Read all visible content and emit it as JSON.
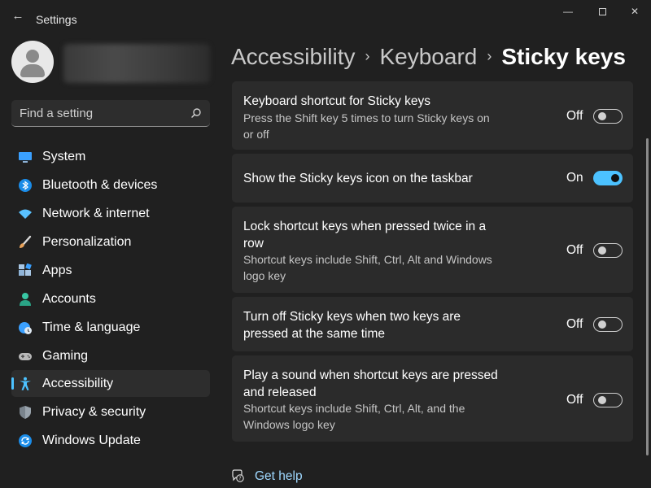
{
  "window": {
    "title": "Settings",
    "back_icon": "←",
    "minimize_icon": "—",
    "close_icon": "✕"
  },
  "search": {
    "placeholder": "Find a setting"
  },
  "sidebar": {
    "items": [
      {
        "label": "System",
        "icon": "system-icon",
        "color": "#3aa0ff"
      },
      {
        "label": "Bluetooth & devices",
        "icon": "bluetooth-icon",
        "color": "#1a8ce8"
      },
      {
        "label": "Network & internet",
        "icon": "wifi-icon",
        "color": "#59c1ff"
      },
      {
        "label": "Personalization",
        "icon": "brush-icon",
        "color": "#e8a25a"
      },
      {
        "label": "Apps",
        "icon": "apps-icon",
        "color": "#8fb4d8"
      },
      {
        "label": "Accounts",
        "icon": "accounts-icon",
        "color": "#38c7a4"
      },
      {
        "label": "Time & language",
        "icon": "globe-clock-icon",
        "color": "#3aa0ff"
      },
      {
        "label": "Gaming",
        "icon": "gamepad-icon",
        "color": "#b8b8b8"
      },
      {
        "label": "Accessibility",
        "icon": "accessibility-icon",
        "color": "#4cc2ff",
        "selected": true
      },
      {
        "label": "Privacy & security",
        "icon": "shield-icon",
        "color": "#9aa4ad"
      },
      {
        "label": "Windows Update",
        "icon": "update-icon",
        "color": "#1a8ce8"
      }
    ]
  },
  "breadcrumb": {
    "items": [
      "Accessibility",
      "Keyboard"
    ],
    "separator": "›",
    "current": "Sticky keys"
  },
  "settings": [
    {
      "title": "Keyboard shortcut for Sticky keys",
      "description": "Press the Shift key 5 times to turn Sticky keys on or off",
      "state": "Off",
      "on": false
    },
    {
      "title": "Show the Sticky keys icon on the taskbar",
      "description": "",
      "state": "On",
      "on": true
    },
    {
      "title": "Lock shortcut keys when pressed twice in a row",
      "description": "Shortcut keys include Shift, Ctrl, Alt and Windows logo key",
      "state": "Off",
      "on": false
    },
    {
      "title": "Turn off Sticky keys when two keys are pressed at the same time",
      "description": "",
      "state": "Off",
      "on": false
    },
    {
      "title": "Play a sound when shortcut keys are pressed and released",
      "description": "Shortcut keys include Shift, Ctrl, Alt, and the Windows logo key",
      "state": "Off",
      "on": false
    }
  ],
  "help": {
    "label": "Get help",
    "icon": "help-chat-icon"
  },
  "colors": {
    "accent": "#4cc2ff",
    "background": "#202020",
    "card": "#2b2b2b"
  }
}
